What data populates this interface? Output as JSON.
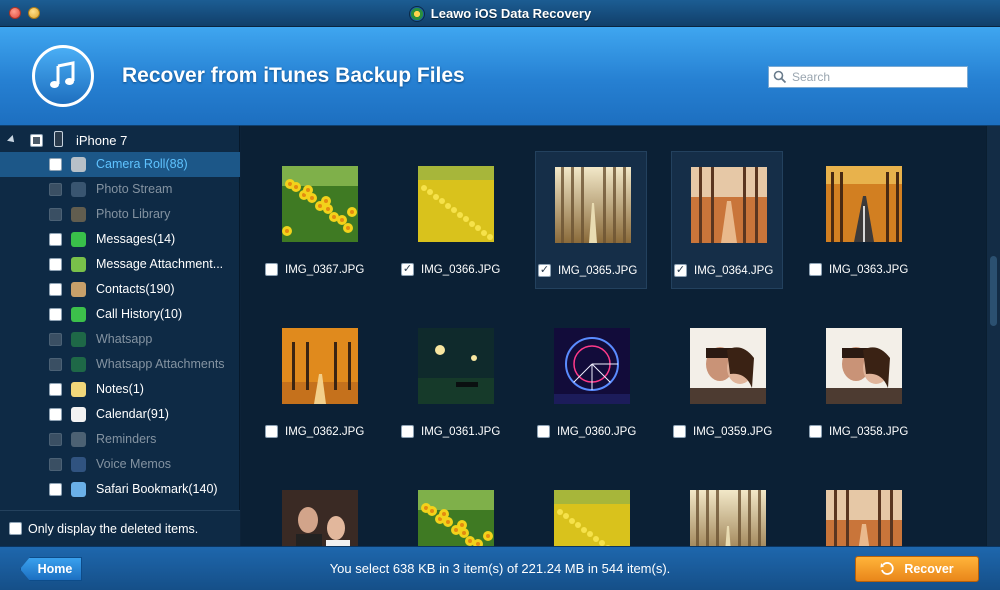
{
  "window": {
    "title": "Leawo iOS Data Recovery"
  },
  "header": {
    "title": "Recover from iTunes Backup Files",
    "search_placeholder": "Search"
  },
  "sidebar": {
    "device": "iPhone 7",
    "items": [
      {
        "label": "Camera Roll(88)",
        "icon": "camera-roll-icon",
        "color": "#b7c0c8",
        "state": "enabled",
        "selected": true
      },
      {
        "label": "Photo Stream",
        "icon": "photo-stream-icon",
        "color": "#6f8aa3",
        "state": "disabled",
        "selected": false
      },
      {
        "label": "Photo Library",
        "icon": "photo-library-icon",
        "color": "#c89b5a",
        "state": "disabled",
        "selected": false
      },
      {
        "label": "Messages(14)",
        "icon": "messages-icon",
        "color": "#39c04a",
        "state": "enabled",
        "selected": false
      },
      {
        "label": "Message Attachment...",
        "icon": "message-attachment-icon",
        "color": "#79c14a",
        "state": "enabled",
        "selected": false
      },
      {
        "label": "Contacts(190)",
        "icon": "contacts-icon",
        "color": "#c7a06a",
        "state": "enabled",
        "selected": false
      },
      {
        "label": "Call History(10)",
        "icon": "call-history-icon",
        "color": "#3cc04b",
        "state": "enabled",
        "selected": false
      },
      {
        "label": "Whatsapp",
        "icon": "whatsapp-icon",
        "color": "#33b44a",
        "state": "disabled",
        "selected": false
      },
      {
        "label": "Whatsapp Attachments",
        "icon": "whatsapp-attachments-icon",
        "color": "#33b44a",
        "state": "disabled",
        "selected": false
      },
      {
        "label": "Notes(1)",
        "icon": "notes-icon",
        "color": "#f1d77a",
        "state": "enabled",
        "selected": false
      },
      {
        "label": "Calendar(91)",
        "icon": "calendar-icon",
        "color": "#f2f2f2",
        "state": "enabled",
        "selected": false
      },
      {
        "label": "Reminders",
        "icon": "reminders-icon",
        "color": "#9aa3ab",
        "state": "disabled",
        "selected": false
      },
      {
        "label": "Voice Memos",
        "icon": "voice-memos-icon",
        "color": "#5b86c7",
        "state": "disabled",
        "selected": false
      },
      {
        "label": "Safari Bookmark(140)",
        "icon": "safari-bookmark-icon",
        "color": "#6ab0e8",
        "state": "enabled",
        "selected": false
      }
    ],
    "deleted_only_label": "Only display the deleted items."
  },
  "grid": {
    "items": [
      {
        "name": "IMG_0367.JPG",
        "checked": false,
        "selected": false,
        "scene": "daffodils"
      },
      {
        "name": "IMG_0366.JPG",
        "checked": true,
        "selected": false,
        "scene": "yellow-field"
      },
      {
        "name": "IMG_0365.JPG",
        "checked": true,
        "selected": true,
        "scene": "misty-forest"
      },
      {
        "name": "IMG_0364.JPG",
        "checked": true,
        "selected": true,
        "scene": "autumn-path"
      },
      {
        "name": "IMG_0363.JPG",
        "checked": false,
        "selected": false,
        "scene": "autumn-road"
      },
      {
        "name": "IMG_0362.JPG",
        "checked": false,
        "selected": false,
        "scene": "autumn-park"
      },
      {
        "name": "IMG_0361.JPG",
        "checked": false,
        "selected": false,
        "scene": "night-park"
      },
      {
        "name": "IMG_0360.JPG",
        "checked": false,
        "selected": false,
        "scene": "ferris-wheel"
      },
      {
        "name": "IMG_0359.JPG",
        "checked": false,
        "selected": false,
        "scene": "couple"
      },
      {
        "name": "IMG_0358.JPG",
        "checked": false,
        "selected": false,
        "scene": "couple"
      },
      {
        "name": "",
        "checked": false,
        "selected": false,
        "scene": "portrait"
      },
      {
        "name": "",
        "checked": false,
        "selected": false,
        "scene": "daffodils"
      },
      {
        "name": "",
        "checked": false,
        "selected": false,
        "scene": "yellow-field"
      },
      {
        "name": "",
        "checked": false,
        "selected": false,
        "scene": "misty-forest"
      },
      {
        "name": "",
        "checked": false,
        "selected": false,
        "scene": "autumn-path"
      }
    ]
  },
  "footer": {
    "home_label": "Home",
    "status": "You select 638 KB in 3 item(s) of 221.24 MB in 544 item(s).",
    "recover_label": "Recover"
  },
  "colors": {
    "accent": "#2680d2",
    "recover": "#f39a27",
    "selected_text": "#5fc3ff"
  }
}
